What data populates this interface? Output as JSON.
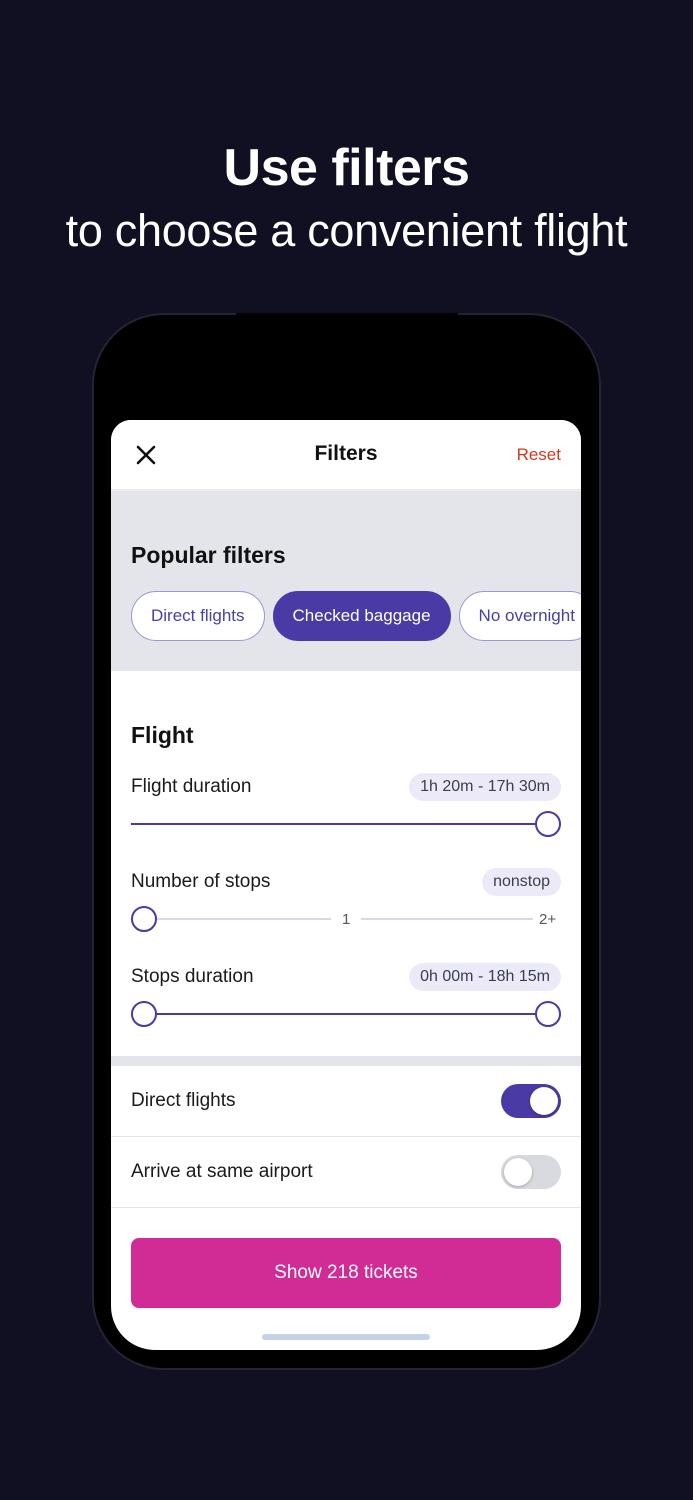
{
  "promo": {
    "headline": "Use filters",
    "subheadline": "to choose a convenient flight"
  },
  "header": {
    "title": "Filters",
    "reset_label": "Reset",
    "close_icon": "close-icon"
  },
  "popular": {
    "title": "Popular filters",
    "chips": [
      {
        "label": "Direct flights",
        "active": false
      },
      {
        "label": "Checked baggage",
        "active": true
      },
      {
        "label": "No overnight",
        "active": false
      }
    ]
  },
  "flight": {
    "title": "Flight",
    "duration": {
      "label": "Flight duration",
      "value": "1h 20m - 17h 30m"
    },
    "stops": {
      "label": "Number of stops",
      "value": "nonstop",
      "ticks": [
        "1",
        "2+"
      ]
    },
    "stops_duration": {
      "label": "Stops duration",
      "value": "0h 00m - 18h 15m"
    }
  },
  "toggles": [
    {
      "label": "Direct flights",
      "on": true
    },
    {
      "label": "Arrive at same airport",
      "on": false
    }
  ],
  "cta": {
    "label": "Show 218 tickets"
  },
  "colors": {
    "background": "#110f22",
    "accent": "#4a3aa6",
    "cta": "#d12b96",
    "reset": "#d2391f"
  }
}
